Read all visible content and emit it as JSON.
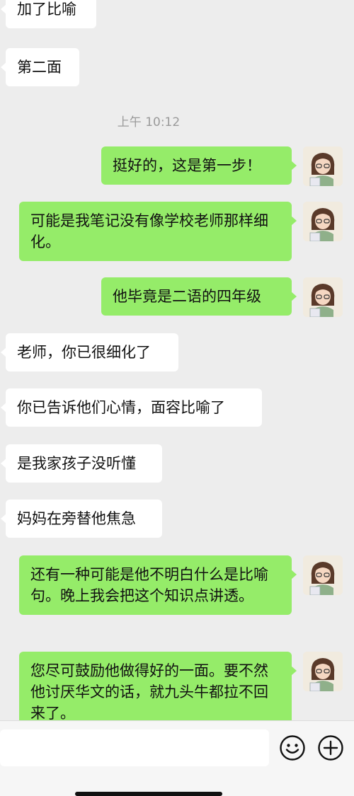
{
  "chat": {
    "timestamp": "上午 10:12",
    "messages": [
      {
        "dir": "in",
        "text": "加了比喻"
      },
      {
        "dir": "in",
        "text": "第二面"
      },
      {
        "dir": "out",
        "text": "挺好的，这是第一步！"
      },
      {
        "dir": "out",
        "text": "可能是我笔记没有像学校老师那样细化。"
      },
      {
        "dir": "out",
        "text": "他毕竟是二语的四年级"
      },
      {
        "dir": "in",
        "text": "老师，你已很细化了"
      },
      {
        "dir": "in",
        "text": "你已告诉他们心情，面容比喻了"
      },
      {
        "dir": "in",
        "text": "是我家孩子没听懂"
      },
      {
        "dir": "in",
        "text": "妈妈在旁替他焦急"
      },
      {
        "dir": "out",
        "text": "还有一种可能是他不明白什么是比喻句。晚上我会把这个知识点讲透。"
      },
      {
        "dir": "out",
        "text": "您尽可鼓励他做得好的一面。要不然他讨厌华文的话，就九头牛都拉不回来了。"
      }
    ]
  },
  "input_bar": {
    "text_value": "",
    "emoji_icon": "emoji-icon",
    "plus_icon": "plus-icon"
  },
  "colors": {
    "background": "#ededed",
    "outgoing_bubble": "#95ec69",
    "incoming_bubble": "#ffffff",
    "timestamp": "#9a9a9a"
  }
}
